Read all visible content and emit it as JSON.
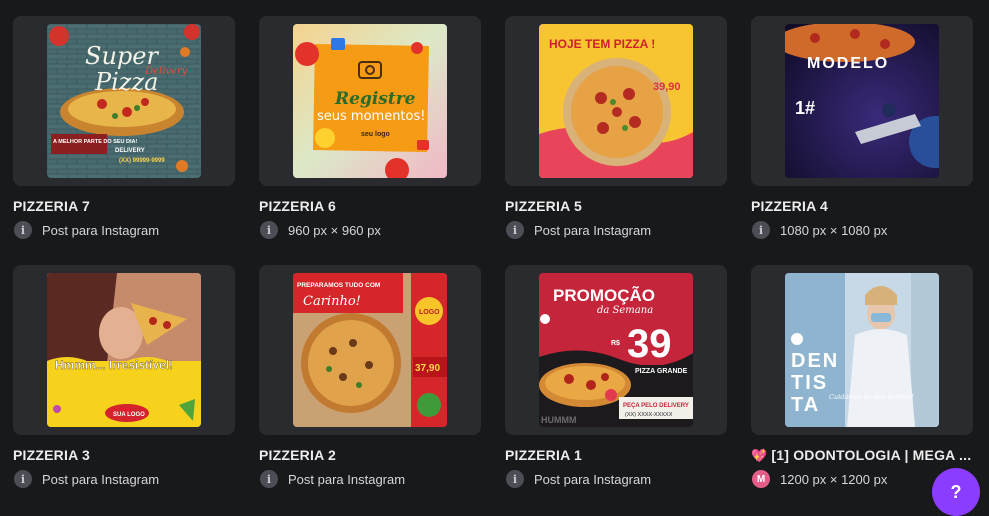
{
  "cards": [
    {
      "title": "PIZZERIA 7",
      "meta": "Post para Instagram",
      "info_icon": "i",
      "thumb_text": {
        "line1": "Super",
        "line2": "Pizza",
        "delivery": "Delivery",
        "tag": "A MELHOR PARTE DO SEU DIA!",
        "phone": "(XX) 99999-9999",
        "delivery2": "DELIVERY"
      }
    },
    {
      "title": "PIZZERIA 6",
      "meta": "960 px × 960 px",
      "info_icon": "i",
      "thumb_text": {
        "line1": "Registre",
        "line2": "seus momentos!",
        "logo": "seu logo"
      }
    },
    {
      "title": "PIZZERIA 5",
      "meta": "Post para Instagram",
      "info_icon": "i",
      "thumb_text": {
        "headline": "HOJE TEM PIZZA !",
        "price": "39,90"
      }
    },
    {
      "title": "PIZZERIA 4",
      "meta": "1080 px × 1080 px",
      "info_icon": "i",
      "thumb_text": {
        "headline": "MODELO",
        "number": "1#"
      }
    },
    {
      "title": "PIZZERIA 3",
      "meta": "Post para Instagram",
      "info_icon": "i",
      "thumb_text": {
        "headline": "Hmmm... Irresistível!",
        "logo": "SUA LOGO"
      }
    },
    {
      "title": "PIZZERIA 2",
      "meta": "Post para Instagram",
      "info_icon": "i",
      "thumb_text": {
        "line1": "PREPARAMOS TUDO COM",
        "line2": "Carinho!",
        "logo": "LOGO",
        "price": "37,90"
      }
    },
    {
      "title": "PIZZERIA 1",
      "meta": "Post para Instagram",
      "info_icon": "i",
      "thumb_text": {
        "line1": "PROMOÇÃO",
        "line2": "da Semana",
        "currency": "R$",
        "price": "39",
        "sub": "PIZZA GRANDE",
        "cta": "PEÇA PELO DELIVERY",
        "phone": "(XX) XXXX-XXXXX",
        "humm": "HUMMM"
      }
    },
    {
      "title": "[1] ODONTOLOGIA | MEGA ...",
      "meta": "1200 px × 1200 px",
      "avatar": "M",
      "heart": "💖",
      "thumb_text": {
        "line1": "DEN",
        "line2": "TIS",
        "line3": "TA",
        "script": "Cuidamos do seu Sorriso!"
      }
    }
  ],
  "help_button": "?",
  "colors": {
    "background": "#18191b",
    "card": "#2a2b2e",
    "accent": "#8b3dff"
  }
}
